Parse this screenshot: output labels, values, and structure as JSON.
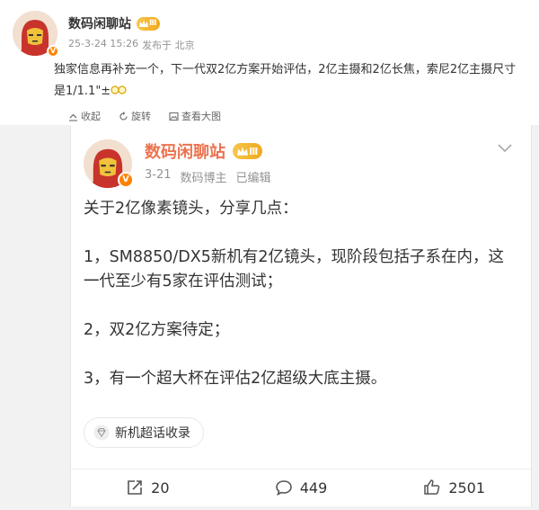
{
  "post": {
    "author_name": "数码闲聊站",
    "level_badge": "Ⅲ",
    "time": "25-3-24 15:26",
    "source_label": "发布于 北京",
    "text": "独家信息再补充一个，下一代双2亿方案开始评估，2亿主摄和2亿长焦，索尼2亿主摄尺寸是1/1.1\"±",
    "actions": {
      "favorite": "收起",
      "repost": "旋转",
      "view_large": "查看大图"
    }
  },
  "repost": {
    "author_name": "数码闲聊站",
    "level_badge": "Ⅲ",
    "date": "3-21",
    "role": "数码博主",
    "edited": "已编辑",
    "paragraphs": [
      "关于2亿像素镜头，分享几点：",
      "1，SM8850/DX5新机有2亿镜头，现阶段包括子系在内，这一代至少有5家在评估测试；",
      "2，双2亿方案待定；",
      "3，有一个超大杯在评估2亿超级大底主摄。"
    ],
    "topic": "新机超话收录",
    "stats": {
      "reposts": "20",
      "comments": "449",
      "likes": "2501"
    }
  },
  "colors": {
    "accent": "#eb7350",
    "verify": "#ff8200",
    "muted": "#939393",
    "page_bg": "#f2f2f2"
  },
  "icons": {
    "verify": "verify-badge-icon",
    "level": "crown-level-icon",
    "favorite": "collapse-icon",
    "rotate": "rotate-icon",
    "view_large": "image-icon",
    "chevron": "chevron-down-icon",
    "topic": "diamond-topic-icon",
    "repost": "repost-icon",
    "comment": "comment-icon",
    "like": "thumb-up-icon"
  }
}
